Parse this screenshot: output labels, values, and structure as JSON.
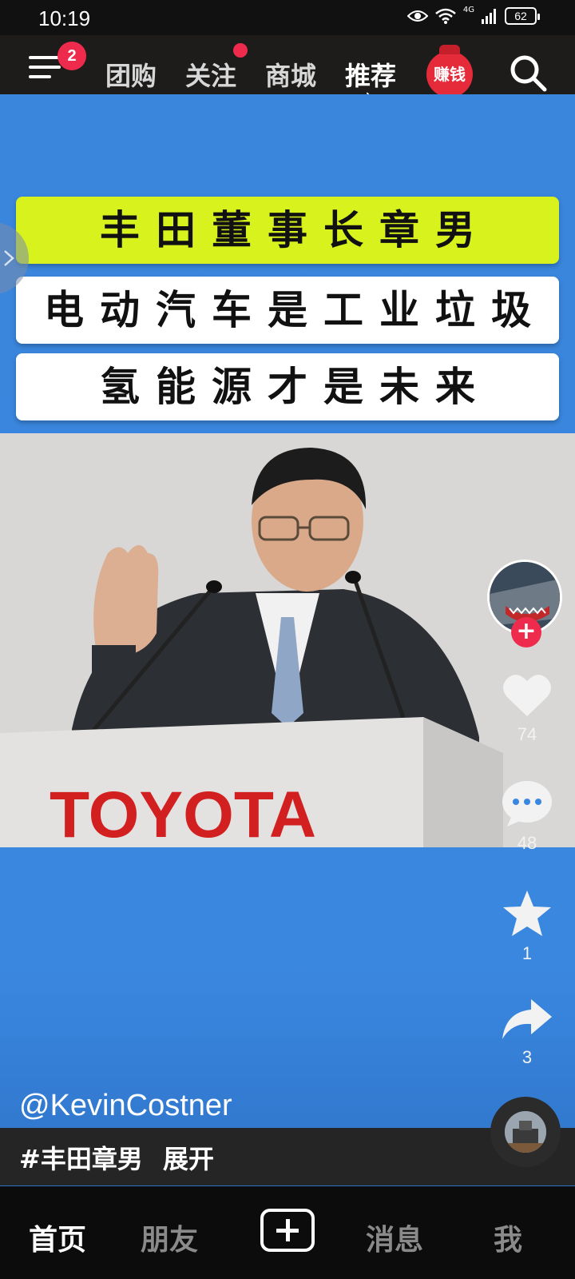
{
  "status_bar": {
    "time": "10:19",
    "battery": "62",
    "network": "4G"
  },
  "top_nav": {
    "menu_badge": "2",
    "tabs": [
      {
        "label": "团购"
      },
      {
        "label": "关注"
      },
      {
        "label": "商城"
      },
      {
        "label": "推荐"
      }
    ],
    "earn_label": "赚钱"
  },
  "video": {
    "headline_lines": [
      "丰田董事长章男",
      "电动汽车是工业垃圾",
      "氢能源才是未来"
    ],
    "brand_text": "TOYOTA",
    "author": "@KevinCostner",
    "hashtag": "#丰田章男",
    "expand_label": "展开"
  },
  "actions": {
    "likes": "74",
    "comments": "48",
    "favorites": "1",
    "shares": "3"
  },
  "bottom_nav": {
    "items": [
      {
        "label": "首页"
      },
      {
        "label": "朋友"
      },
      {
        "label": "消息"
      },
      {
        "label": "我"
      }
    ]
  },
  "colors": {
    "accent_red": "#ef2b4d",
    "background_blue": "#3a87e0",
    "headline_yellow": "#d8f21e"
  }
}
